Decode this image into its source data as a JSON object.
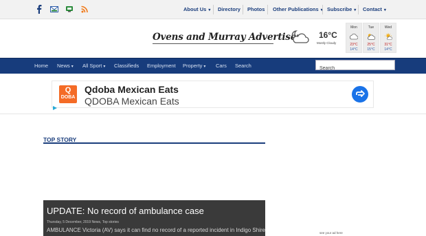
{
  "social": {
    "facebook": "facebook-icon",
    "email": "email-icon",
    "app": "app-icon",
    "rss": "rss-icon"
  },
  "topnav": {
    "items": [
      {
        "label": "About Us",
        "dropdown": true
      },
      {
        "label": "Directory",
        "dropdown": false
      },
      {
        "label": "Photos",
        "dropdown": false
      },
      {
        "label": "Other Publications",
        "dropdown": true
      },
      {
        "label": "Subscribe",
        "dropdown": true
      },
      {
        "label": "Contact",
        "dropdown": true
      }
    ]
  },
  "masthead": {
    "logo_text": "Ovens and Murray Advertiser"
  },
  "weather": {
    "current_temp": "16°C",
    "current_desc": "Mostly Cloudy",
    "forecast": [
      {
        "day": "Mon",
        "hi": "23°C",
        "lo": "14°C"
      },
      {
        "day": "Tue",
        "hi": "25°C",
        "lo": "15°C"
      },
      {
        "day": "Wed",
        "hi": "31°C",
        "lo": "14°C"
      }
    ]
  },
  "mainnav": {
    "items": [
      {
        "label": "Home",
        "dropdown": false
      },
      {
        "label": "News",
        "dropdown": true
      },
      {
        "label": "All Sport",
        "dropdown": true
      },
      {
        "label": "Classifieds",
        "dropdown": false
      },
      {
        "label": "Employment",
        "dropdown": false
      },
      {
        "label": "Property",
        "dropdown": true
      },
      {
        "label": "Cars",
        "dropdown": false
      },
      {
        "label": "Search",
        "dropdown": false
      }
    ],
    "search_placeholder": "Search"
  },
  "ad": {
    "brand_line1": "Q",
    "brand_line2": "DOBA",
    "title": "Qdoba Mexican Eats",
    "subtitle": "QDOBA Mexican Eats"
  },
  "top_story": {
    "section_title": "TOP STORY",
    "headline": "UPDATE: No record of ambulance case",
    "meta": "Thursday, 5 December, 2019 News, Top stories",
    "excerpt": "AMBULANCE Victoria (AV) says it can find no record of a reported incident in Indigo Shire"
  },
  "sidebar": {
    "ad_text": "see your ad here"
  },
  "colors": {
    "nav_blue": "#173c7c",
    "link_blue": "#1a3d7c",
    "ad_orange": "#f46b26",
    "ad_blue": "#1a73e8"
  }
}
